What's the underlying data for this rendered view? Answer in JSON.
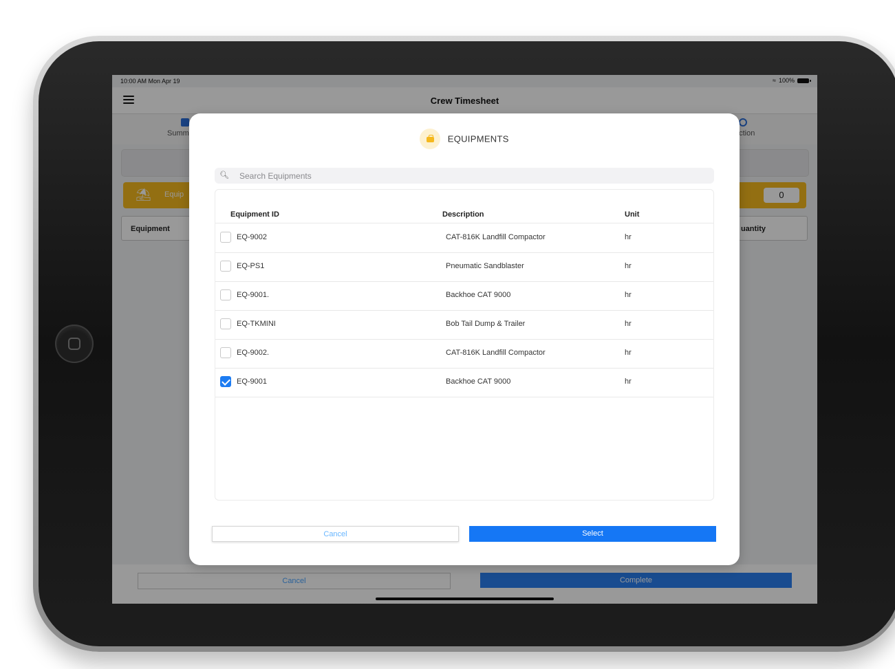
{
  "status_bar": {
    "time": "10:00 AM  Mon Apr 19",
    "battery": "100%"
  },
  "nav": {
    "title": "Crew Timesheet"
  },
  "tabs": {
    "left_label": "Summ",
    "right_label": "uction"
  },
  "equipment_bar": {
    "label": "Equip",
    "count": "0"
  },
  "background_table": {
    "col_equipment": "Equipment",
    "col_quantity": "uantity"
  },
  "footer": {
    "cancel_label": "Cancel",
    "complete_label": "Complete"
  },
  "modal": {
    "title": "EQUIPMENTS",
    "search_placeholder": "Search Equipments",
    "columns": {
      "id": "Equipment ID",
      "description": "Description",
      "unit": "Unit"
    },
    "rows": [
      {
        "id": "EQ-9002",
        "description": "CAT-816K Landfill Compactor",
        "unit": "hr",
        "checked": false
      },
      {
        "id": "EQ-PS1",
        "description": "Pneumatic Sandblaster",
        "unit": "hr",
        "checked": false
      },
      {
        "id": "EQ-9001.",
        "description": "Backhoe CAT 9000",
        "unit": "hr",
        "checked": false
      },
      {
        "id": "EQ-TKMINI",
        "description": "Bob Tail Dump & Trailer",
        "unit": "hr",
        "checked": false
      },
      {
        "id": "EQ-9002.",
        "description": "CAT-816K Landfill Compactor",
        "unit": "hr",
        "checked": false
      },
      {
        "id": "EQ-9001",
        "description": "Backhoe CAT 9000",
        "unit": "hr",
        "checked": true
      }
    ],
    "cancel_label": "Cancel",
    "select_label": "Select"
  },
  "colors": {
    "accent": "#1577f5",
    "warning": "#f5b91e"
  }
}
